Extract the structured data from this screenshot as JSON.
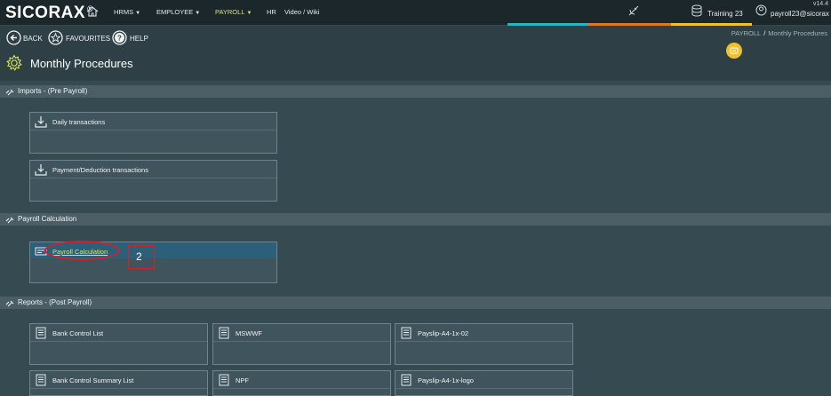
{
  "app": {
    "name": "SICORAX",
    "mark": "®",
    "version": "v14.4"
  },
  "nav": [
    {
      "label": "HRMS",
      "dropdown": true
    },
    {
      "label": "EMPLOYEE",
      "dropdown": true
    },
    {
      "label": "PAYROLL",
      "dropdown": true,
      "active": true
    },
    {
      "label": "HR",
      "dropdown": false
    },
    {
      "label": "Video / Wiki",
      "dropdown": false
    }
  ],
  "topbar": {
    "database": "Training 23",
    "user": "payroll23@sicorax"
  },
  "toolbar": {
    "back": "BACK",
    "favourites": "FAVOURITES",
    "help": "HELP"
  },
  "breadcrumb": {
    "root": "PAYROLL",
    "sep": "/",
    "current": "Monthly Procedures"
  },
  "page": {
    "title": "Monthly Procedures"
  },
  "sections": [
    {
      "title": "Imports - (Pre Payroll)",
      "cards": [
        "Daily transactions",
        "Payment/Deduction transactions"
      ]
    },
    {
      "title": "Payroll Calculation",
      "cards": [
        "Payroll Calculation"
      ]
    },
    {
      "title": "Reports - (Post Payroll)",
      "cards": [
        "Bank Control List",
        "MSWWF",
        "Payslip-A4-1x-02",
        "Bank Control Summary List",
        "NPF",
        "Payslip-A4-1x-logo"
      ]
    }
  ],
  "annotation": {
    "number": "2",
    "color": "#d4202a"
  },
  "colors": {
    "accent": "#d8e85a",
    "stripes": [
      "#2bb3c4",
      "#e0761f",
      "#f0c12a"
    ]
  },
  "icons": {
    "card_import": "download-icon",
    "card_calc": "form-icon",
    "card_report": "document-icon"
  }
}
